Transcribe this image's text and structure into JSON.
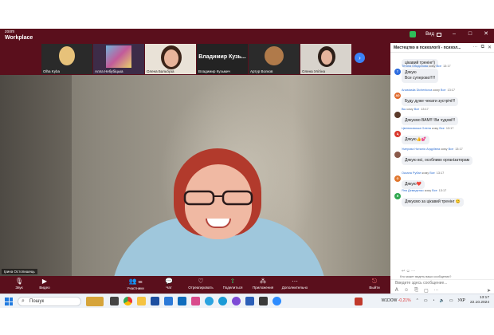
{
  "app": {
    "logo_small": "zoom",
    "logo_big": "Workplace",
    "view_label": "Вид"
  },
  "thumbnails": [
    {
      "name": "Olha Kyba"
    },
    {
      "name": "Алла Небубіцька"
    },
    {
      "name": "Олена Бальбуза"
    },
    {
      "name": "Владимир Кузьмич",
      "big_name": "Владимир  Кузь..."
    },
    {
      "name": "Артур Волков"
    },
    {
      "name": "Олена Улітіна"
    }
  ],
  "main_video": {
    "participant_name": "Ірина Остопишець"
  },
  "chat": {
    "title": "Мистецтво в психології - психол...",
    "messages": [
      {
        "sender": "",
        "to": "",
        "time": "",
        "text": "цікавий тренінг!)",
        "avatar": "",
        "avatar_color": ""
      },
      {
        "sender": "Тетяна Обидонова",
        "to": "Все",
        "time": "13:17",
        "text": "Дякую\nВсе суперово!!!!!",
        "avatar": "Т",
        "avatar_color": "#2d6cdf"
      },
      {
        "sender": "Anastasiia Dichenkova",
        "to": "Все",
        "time": "13:17",
        "text": "Буду дуже чекати зустрічі!!!",
        "avatar": "AD",
        "avatar_color": "#e06a2d"
      },
      {
        "sender": "Вы",
        "to": "Все",
        "time": "13:17",
        "text": "Дякуємо ВАМ!!! Ви чудові!!!",
        "avatar": "",
        "avatar_color": "#5a3a2a"
      },
      {
        "sender": "Цвілюховська Олена",
        "to": "Все",
        "time": "13:17",
        "text": "Дякую👍💕",
        "avatar": "Ц",
        "avatar_color": "#d9362b"
      },
      {
        "sender": "Умерова Наталія Андріївна",
        "to": "Все",
        "time": "13:17",
        "text": "Дякую всі, особливо організаторам",
        "avatar": "",
        "avatar_color": "#8a5a4a"
      },
      {
        "sender": "Оксана Рубан",
        "to": "Все",
        "time": "13:17",
        "text": "Дякую❤️",
        "avatar": "О",
        "avatar_color": "#e0762d"
      },
      {
        "sender": "Яна Демиденко",
        "to": "Все",
        "time": "13:17",
        "text": "Дякуємо за цікавий тренінг 😊",
        "avatar": "Я",
        "avatar_color": "#2fa84f"
      }
    ],
    "who_can_see": "Кто может видеть ваши сообщения?",
    "to_label": "Кому:",
    "to_value": "Все",
    "input_placeholder": "Введите здесь сообщение..."
  },
  "toolbar": {
    "buttons": [
      {
        "label": "Звук",
        "icon": "microphone-icon"
      },
      {
        "label": "Видео",
        "icon": "video-camera-icon"
      },
      {
        "label": "Участники",
        "icon": "participants-icon",
        "count": "98"
      },
      {
        "label": "Чат",
        "icon": "chat-icon"
      },
      {
        "label": "Отреагировать",
        "icon": "heart-icon"
      },
      {
        "label": "Поделиться",
        "icon": "share-screen-icon"
      },
      {
        "label": "Приложения",
        "icon": "apps-icon"
      },
      {
        "label": "Дополнительно",
        "icon": "more-icon"
      },
      {
        "label": "Выйти",
        "icon": "leave-icon"
      }
    ]
  },
  "taskbar": {
    "search_text": "Пошук",
    "stock_name": "W1DOW",
    "stock_change": "-0,21%",
    "language": "УКР",
    "time": "13:17",
    "date": "22.10.2024"
  }
}
